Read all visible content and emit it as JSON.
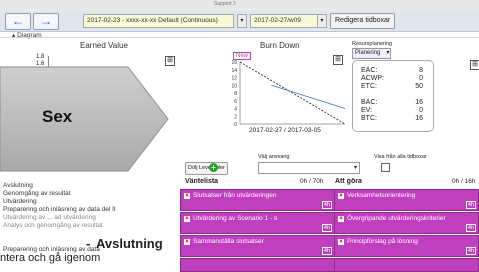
{
  "toolbar": {
    "period_select": "2017-02-23 - xxxx-xx-xx Default (Continuous)",
    "week_select": "2017-02-27/w09",
    "edit_button": "Redigera tidboxar",
    "top_sub": "Support 3"
  },
  "diagram": {
    "label": "Diagram",
    "earned_value": {
      "title": "Earned Value",
      "y_ticks": [
        "1.8",
        "1.6"
      ]
    },
    "burn_down": {
      "title": "Burn Down",
      "badge": "New",
      "y_ticks": [
        "16",
        "14",
        "12",
        "10",
        "8",
        "6",
        "4",
        "2",
        "0"
      ],
      "date_range": "2017-02-27 / 2017-03-05",
      "chart_data": {
        "type": "line",
        "ylim": [
          0,
          16
        ],
        "series": [
          {
            "name": "",
            "color": "#333333",
            "dashed": true,
            "points": [
              [
                0,
                16
              ],
              [
                1,
                0
              ]
            ]
          },
          {
            "name": "",
            "color": "#3b6fd8",
            "dashed": false,
            "points": [
              [
                0.3,
                10
              ],
              [
                1,
                4
              ]
            ]
          }
        ]
      }
    },
    "resource": {
      "label": "Resursplanering",
      "select": "Planering",
      "rows": [
        {
          "k": "EAC:",
          "v": "8"
        },
        {
          "k": "ACWP:",
          "v": "0"
        },
        {
          "k": "ETC:",
          "v": "50"
        },
        {
          "k": "BAC:",
          "v": "16"
        },
        {
          "k": "EV:",
          "v": "0"
        },
        {
          "k": "BTC:",
          "v": "16"
        }
      ]
    }
  },
  "board": {
    "hide_button": "Dölj Leverabler",
    "assignee_label": "Välj ansvarig",
    "show_all_label": "Visa från alla tidboxar",
    "waiting": {
      "title": "Väntelista",
      "hours": "0h / 70h"
    },
    "todo": {
      "title": "Att göra",
      "hours": "0h / 16h"
    },
    "waiting_cards": [
      {
        "title": "Slutsatser från utvärderingen",
        "hours": "4h"
      },
      {
        "title": "Utvärdering av Scenario 1 - s",
        "hours": "4h"
      },
      {
        "title": "Sammanställa slutsatser",
        "hours": "4h"
      }
    ],
    "todo_cards": [
      {
        "title": "Verksamhetsorientering",
        "hours": "4h"
      },
      {
        "title": "Övergripande utvärderingskriterier",
        "hours": "4h"
      },
      {
        "title": "Principförslag på lösning",
        "hours": "4h"
      }
    ]
  },
  "tree": [
    "Avslutning",
    "Genomgång av resultat",
    "Utvärdering",
    "Preparering och inläsning av data del II",
    "Utvärdering av ... ad utvärdering",
    "Analys och genomgång av resultat",
    "Preparering och inläsning av data"
  ],
  "overlay": {
    "arrow_label": "Sex",
    "caption_title": "Avslutning",
    "caption_dash": "-",
    "caption_sub": "ntera och gå igenom"
  }
}
